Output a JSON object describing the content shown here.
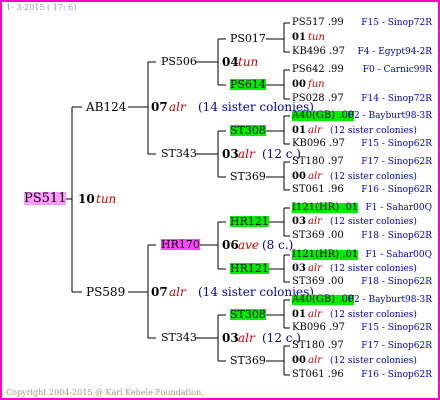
{
  "header": {
    "date_line": "1-  3-2015 ( 17:  6)"
  },
  "footer": {
    "copyright": "Copyright 2004-2015 @ Karl Kehele Foundation."
  },
  "root": {
    "name": "PS511",
    "num": "10",
    "qual": "tun"
  },
  "sire": {
    "name": "AB124",
    "num": "07",
    "qual": "alr",
    "sis": "(14 sister colonies)"
  },
  "sire_sire": {
    "name": "PS506",
    "num": "04",
    "qual": "tun"
  },
  "sire_dam": {
    "name": "ST343",
    "num": "03",
    "qual": "alr",
    "sis": "(12 c.)"
  },
  "dam": {
    "name": "PS589",
    "num": "07",
    "qual": "alr",
    "sis": "(14 sister colonies)"
  },
  "dam_sire": {
    "name": "HR170",
    "num": "06",
    "qual": "ave",
    "sis": "(8 c.)"
  },
  "dam_dam": {
    "name": "ST343",
    "num": "03",
    "qual": "alr",
    "sis": "(12 c.)"
  },
  "gen3": {
    "ss_s": "PS017",
    "ss_d": "PS614",
    "sd_s": "ST308",
    "sd_d": "ST369",
    "ds_s": "HR121",
    "ds_d": "HR121",
    "dd_s": "ST308",
    "dd_d": "ST369"
  },
  "gen4": [
    {
      "name": "PS517 .99",
      "src": "F15 - Sinop72R"
    },
    {
      "num": "01",
      "qual": "tun"
    },
    {
      "name": "KB496 .97",
      "src": "F4 - Egypt94-2R"
    },
    {
      "name": "PS642 .99",
      "src": "F0 - Carnic99R"
    },
    {
      "num": "00",
      "qual": "fun"
    },
    {
      "name": "PS028 .97",
      "src": "F14 - Sinop72R"
    },
    {
      "name": "A40(GB) .00",
      "src": "F2 - Bayburt98-3R"
    },
    {
      "num": "01",
      "qual": "alr",
      "sis": "(12 sister colonies)"
    },
    {
      "name": "KB096 .97",
      "src": "F15 - Sinop62R"
    },
    {
      "name": "ST180 .97",
      "src": "F17 - Sinop62R"
    },
    {
      "num": "00",
      "qual": "alr",
      "sis": "(12 sister colonies)"
    },
    {
      "name": "ST061 .96",
      "src": "F16 - Sinop62R"
    },
    {
      "name": "I121(HR) .01",
      "src": "F1 - Sahar00Q"
    },
    {
      "num": "03",
      "qual": "alr",
      "sis": "(12 sister colonies)"
    },
    {
      "name": "ST369 .00",
      "src": "F18 - Sinop62R"
    },
    {
      "name": "I121(HR) .01",
      "src": "F1 - Sahar00Q"
    },
    {
      "num": "03",
      "qual": "alr",
      "sis": "(12 sister colonies)"
    },
    {
      "name": "ST369 .00",
      "src": "F18 - Sinop62R"
    },
    {
      "name": "A40(GB) .00",
      "src": "F2 - Bayburt98-3R"
    },
    {
      "num": "01",
      "qual": "alr",
      "sis": "(12 sister colonies)"
    },
    {
      "name": "KB096 .97",
      "src": "F15 - Sinop62R"
    },
    {
      "name": "ST180 .97",
      "src": "F17 - Sinop62R"
    },
    {
      "num": "00",
      "qual": "alr",
      "sis": "(12 sister colonies)"
    },
    {
      "name": "ST061 .96",
      "src": "F16 - Sinop62R"
    }
  ],
  "colors": {
    "frame": "#ff00cc",
    "highlight_green": "#00ee00",
    "highlight_magenta": "#ff44ff",
    "source_blue": "#0000cc",
    "quality_red": "#cc0000"
  }
}
